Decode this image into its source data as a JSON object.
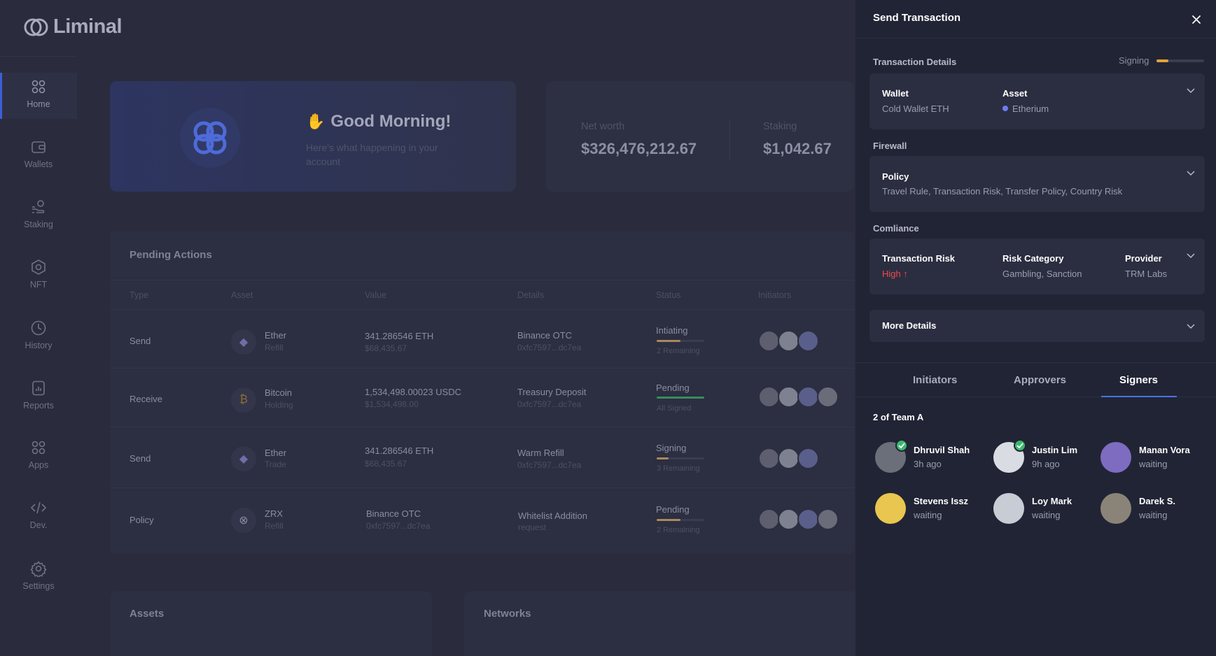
{
  "app": {
    "logo_text": "Liminal"
  },
  "nav": [
    {
      "label": "Home",
      "icon": "home-icon"
    },
    {
      "label": "Wallets",
      "icon": "wallet-icon"
    },
    {
      "label": "Staking",
      "icon": "staking-icon"
    },
    {
      "label": "NFT",
      "icon": "nft-icon"
    },
    {
      "label": "History",
      "icon": "history-icon"
    },
    {
      "label": "Reports",
      "icon": "reports-icon"
    },
    {
      "label": "Apps",
      "icon": "apps-icon"
    },
    {
      "label": "Dev.",
      "icon": "code-icon"
    },
    {
      "label": "Settings",
      "icon": "settings-icon"
    }
  ],
  "hero": {
    "greeting": "Good Morning!",
    "subtitle": "Here's what happening in your account"
  },
  "stats": {
    "net_worth_label": "Net worth",
    "net_worth_value": "$326,476,212.67",
    "staking_label": "Staking",
    "staking_value": "$1,042.67"
  },
  "pending": {
    "title": "Pending Actions",
    "headers": [
      "Type",
      "Asset",
      "Value",
      "Details",
      "Status",
      "Initiators"
    ],
    "rows": [
      {
        "type": "Send",
        "asset": "Ether",
        "asset_sub": "Refill",
        "asset_icon": "ethereum-icon",
        "value": "341.286546 ETH",
        "value_sub": "$68,435.67",
        "details": "Binance OTC",
        "details_sub": "0xfc7597...dc7ea",
        "status": "Intiating",
        "status_sub": "2 Remaining",
        "progress": 0.5,
        "color": "#a78a5a"
      },
      {
        "type": "Receive",
        "asset": "Bitcoin",
        "asset_sub": "Holding",
        "asset_icon": "bitcoin-icon",
        "value": "1,534,498.00023 USDC",
        "value_sub": "$1,534,498.00",
        "details": "Treasury Deposit",
        "details_sub": "0xfc7597...dc7ea",
        "status": "Pending",
        "status_sub": "All Signed",
        "progress": 1.0,
        "color": "#3a8a5e"
      },
      {
        "type": "Send",
        "asset": "Ether",
        "asset_sub": "Trade",
        "asset_icon": "ethereum-icon",
        "value": "341.286546 ETH",
        "value_sub": "$68,435.67",
        "details": "Warm Refill",
        "details_sub": "0xfc7597...dc7ea",
        "status": "Signing",
        "status_sub": "3 Remaining",
        "progress": 0.25,
        "color": "#a78a5a"
      },
      {
        "type": "Policy",
        "asset": "ZRX",
        "asset_sub": "Refill",
        "asset_icon": "zrx-icon",
        "value": "Binance OTC",
        "value_sub": "0xfc7597...dc7ea",
        "details": "Whitelist Addition",
        "details_sub": "request",
        "status": "Pending",
        "status_sub": "2 Remaining",
        "progress": 0.5,
        "color": "#a78a5a"
      }
    ]
  },
  "bottom": {
    "assets_title": "Assets",
    "networks_title": "Networks"
  },
  "drawer": {
    "title": "Send Transaction",
    "details_label": "Transaction Details",
    "signing_label": "Signing",
    "signing_progress": 0.25,
    "wallet_key": "Wallet",
    "wallet_val": "Cold Wallet ETH",
    "asset_key": "Asset",
    "asset_val": "Etherium",
    "firewall_label": "Firewall",
    "policy_key": "Policy",
    "policy_val": "Travel Rule, Transaction Risk, Transfer Policy, Country Risk",
    "compliance_label": "Comliance",
    "risk_key": "Transaction Risk",
    "risk_val": "High ↑",
    "category_key": "Risk Category",
    "category_val": "Gambling, Sanction",
    "provider_key": "Provider",
    "provider_val": "TRM Labs",
    "more_details": "More Details",
    "tabs": [
      "Initiators",
      "Approvers",
      "Signers"
    ],
    "team": "2 of Team A",
    "signers": [
      {
        "name": "Dhruvil Shah",
        "status": "3h ago",
        "signed": true,
        "color": "#6b6f7a"
      },
      {
        "name": "Justin Lim",
        "status": "9h ago",
        "signed": true,
        "color": "#d9dde3"
      },
      {
        "name": "Manan Vora",
        "status": "waiting",
        "signed": false,
        "color": "#7d6cc0"
      },
      {
        "name": "Stevens Issz",
        "status": "waiting",
        "signed": false,
        "color": "#e8c64f"
      },
      {
        "name": "Loy Mark",
        "status": "waiting",
        "signed": false,
        "color": "#c7ccd5"
      },
      {
        "name": "Darek S.",
        "status": "waiting",
        "signed": false,
        "color": "#8a8478"
      }
    ]
  }
}
